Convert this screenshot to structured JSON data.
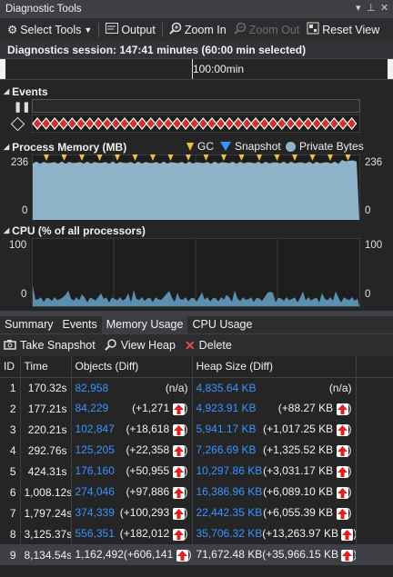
{
  "window": {
    "title": "Diagnostic Tools",
    "pin_icon": "pin-icon",
    "close_icon": "close-icon",
    "dropdown_icon": "window-dropdown-icon"
  },
  "toolbar": {
    "select_tools": "Select Tools",
    "output": "Output",
    "zoom_in": "Zoom In",
    "zoom_out": "Zoom Out",
    "reset_view": "Reset View"
  },
  "session": {
    "text": "Diagnostics session: 147:41 minutes (60:00 min selected)"
  },
  "ruler": {
    "label": "100:00min"
  },
  "events": {
    "title": "Events"
  },
  "memory": {
    "title": "Process Memory (MB)",
    "legend_gc": "GC",
    "legend_snapshot": "Snapshot",
    "legend_private": "Private Bytes",
    "ymax_left": "236",
    "ymin_left": "0",
    "ymax_right": "236",
    "ymin_right": "0",
    "colors": {
      "area": "#8fb3c9",
      "gc": "#f0c040",
      "snapshot": "#3794ff"
    }
  },
  "cpu": {
    "title": "CPU (% of all processors)",
    "ymax_left": "100",
    "ymin_left": "0",
    "ymax_right": "100",
    "ymin_right": "0"
  },
  "tabs": [
    "Summary",
    "Events",
    "Memory Usage",
    "CPU Usage"
  ],
  "active_tab": "Memory Usage",
  "subtoolbar": {
    "take_snapshot": "Take Snapshot",
    "view_heap": "View Heap",
    "delete": "Delete"
  },
  "table": {
    "headers": [
      "ID",
      "Time",
      "Objects (Diff)",
      "Heap Size (Diff)"
    ],
    "rows": [
      {
        "id": "1",
        "time": "170.32s",
        "objects": "82,958",
        "objects_diff": "(n/a)",
        "heap": "4,835.64 KB",
        "heap_diff": "(n/a)",
        "arrow": false
      },
      {
        "id": "2",
        "time": "177.21s",
        "objects": "84,229",
        "objects_diff": "(+1,271",
        "heap": "4,923.91 KB",
        "heap_diff": "(+88.27 KB",
        "arrow": true
      },
      {
        "id": "3",
        "time": "220.21s",
        "objects": "102,847",
        "objects_diff": "(+18,618",
        "heap": "5,941.17 KB",
        "heap_diff": "(+1,017.25 KB",
        "arrow": true
      },
      {
        "id": "4",
        "time": "292.76s",
        "objects": "125,205",
        "objects_diff": "(+22,358",
        "heap": "7,266.69 KB",
        "heap_diff": "(+1,325.52 KB",
        "arrow": true
      },
      {
        "id": "5",
        "time": "424.31s",
        "objects": "176,160",
        "objects_diff": "(+50,955",
        "heap": "10,297.86 KB",
        "heap_diff": "(+3,031.17 KB",
        "arrow": true
      },
      {
        "id": "6",
        "time": "1,008.12s",
        "objects": "274,046",
        "objects_diff": "(+97,886",
        "heap": "16,386.96 KB",
        "heap_diff": "(+6,089.10 KB",
        "arrow": true
      },
      {
        "id": "7",
        "time": "1,797.24s",
        "objects": "374,339",
        "objects_diff": "(+100,293",
        "heap": "22,442.35 KB",
        "heap_diff": "(+6,055.39 KB",
        "arrow": true
      },
      {
        "id": "8",
        "time": "3,125.37s",
        "objects": "556,351",
        "objects_diff": "(+182,012",
        "heap": "35,706.32 KB",
        "heap_diff": "(+13,263.97 KB",
        "arrow": true
      },
      {
        "id": "9",
        "time": "8,134.54s",
        "objects": "1,162,492",
        "objects_diff": "(+606,141",
        "heap": "71,672.48 KB",
        "heap_diff": "(+35,966.15 KB",
        "arrow": true
      }
    ]
  }
}
